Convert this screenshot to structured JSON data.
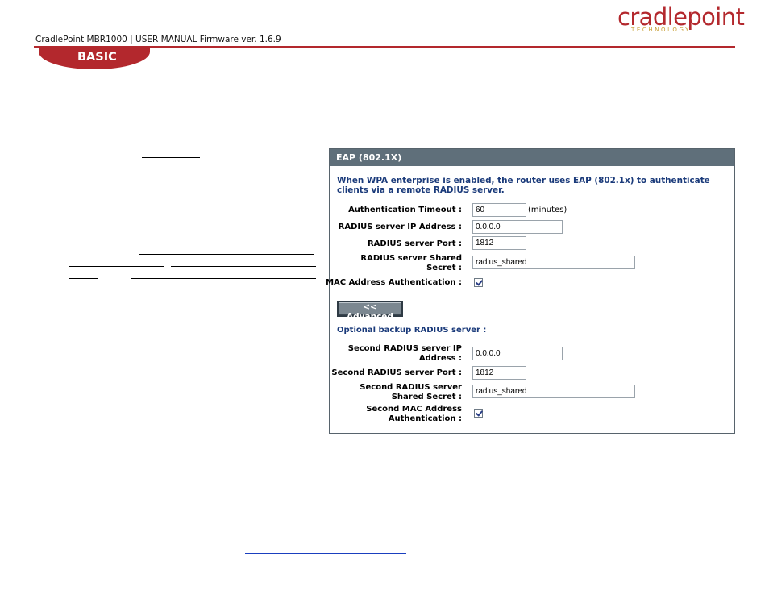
{
  "header": {
    "doc_title": "CradlePoint MBR1000 | USER MANUAL Firmware ver. 1.6.9",
    "logo_text": "cradlepoint",
    "logo_subtext": "TECHNOLOGY",
    "section_tab": "BASIC"
  },
  "colors": {
    "brand_red": "#b3282d",
    "panel_header": "#5f6f7a",
    "intro_text": "#1a3a7a"
  },
  "eap": {
    "title": "EAP (802.1X)",
    "intro": "When WPA enterprise is enabled, the router uses EAP (802.1x) to authenticate clients via a remote RADIUS server.",
    "auth_timeout_label": "Authentication Timeout :",
    "auth_timeout_value": "60",
    "auth_timeout_unit": "(minutes)",
    "radius_ip_label": "RADIUS server IP Address :",
    "radius_ip_value": "0.0.0.0",
    "radius_port_label": "RADIUS server Port :",
    "radius_port_value": "1812",
    "radius_secret_label_1": "RADIUS server Shared",
    "radius_secret_label_2": "Secret :",
    "radius_secret_value": "radius_shared",
    "mac_auth_label": "MAC Address Authentication :",
    "mac_auth_checked": true,
    "advanced_button": "<< Advanced",
    "optional_heading": "Optional backup RADIUS server :",
    "second_ip_label_1": "Second RADIUS server IP",
    "second_ip_label_2": "Address :",
    "second_ip_value": "0.0.0.0",
    "second_port_label": "Second RADIUS server Port :",
    "second_port_value": "1812",
    "second_secret_label_1": "Second RADIUS server",
    "second_secret_label_2": "Shared Secret :",
    "second_secret_value": "radius_shared",
    "second_mac_label_1": "Second MAC Address",
    "second_mac_label_2": "Authentication :",
    "second_mac_checked": true
  }
}
